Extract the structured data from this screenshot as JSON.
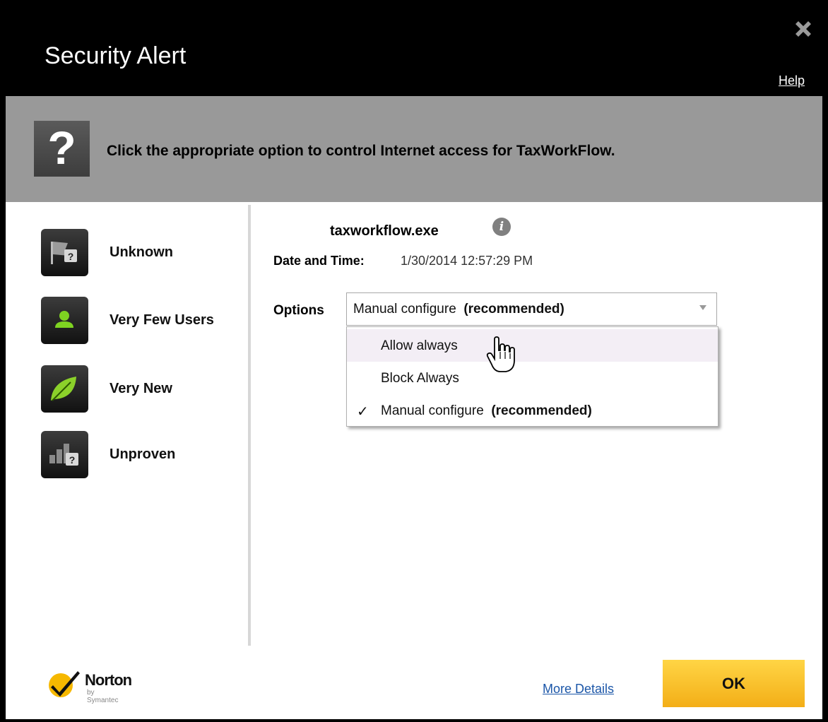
{
  "window": {
    "title": "Security Alert",
    "help_label": "Help"
  },
  "banner": {
    "icon_glyph": "?",
    "message": "Click the appropriate option to control Internet access for TaxWorkFlow."
  },
  "sidebar": {
    "items": [
      {
        "label": "Unknown",
        "icon": "flag-question-icon"
      },
      {
        "label": "Very Few Users",
        "icon": "user-icon"
      },
      {
        "label": "Very New",
        "icon": "leaf-icon"
      },
      {
        "label": "Unproven",
        "icon": "bars-question-icon"
      }
    ]
  },
  "details": {
    "filename": "taxworkflow.exe",
    "info_glyph": "i",
    "date_label": "Date and Time:",
    "date_value": "1/30/2014 12:57:29 PM",
    "options_label": "Options"
  },
  "select": {
    "selected_text": "Manual configure",
    "selected_suffix": "(recommended)",
    "options": [
      {
        "label": "Allow always",
        "suffix": "",
        "checked": false,
        "hover": true
      },
      {
        "label": "Block Always",
        "suffix": "",
        "checked": false,
        "hover": false
      },
      {
        "label": "Manual configure",
        "suffix": "(recommended)",
        "checked": true,
        "hover": false
      }
    ],
    "check_glyph": "✓"
  },
  "footer": {
    "brand": "Norton",
    "brand_sub": "by Symantec",
    "more_details": "More Details",
    "ok_label": "OK"
  },
  "colors": {
    "titlebar": "#000000",
    "banner": "#999999",
    "ok_button": "#f7c12b",
    "link": "#1b56a8",
    "hover_row": "#f3eef5",
    "norton_yellow": "#f6b800"
  }
}
